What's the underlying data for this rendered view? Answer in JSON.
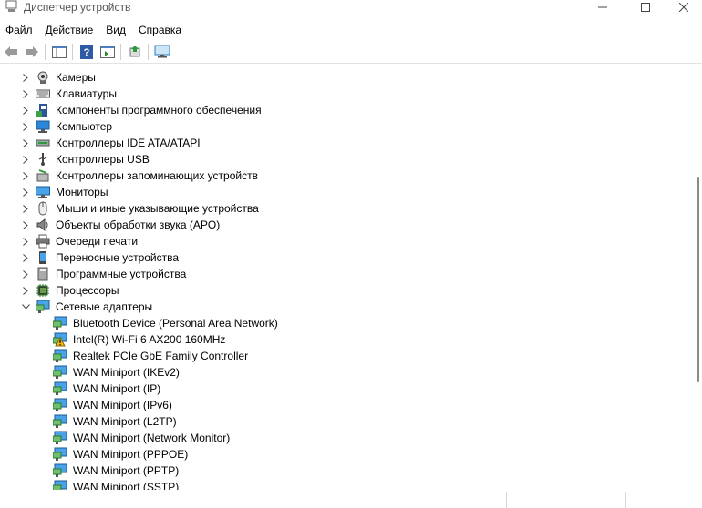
{
  "window": {
    "title": "Диспетчер устройств"
  },
  "menu": [
    "Файл",
    "Действие",
    "Вид",
    "Справка"
  ],
  "toolbar": [
    {
      "name": "back-button",
      "icon": "arrow-left-icon"
    },
    {
      "name": "forward-button",
      "icon": "arrow-right-icon"
    },
    {
      "name": "show-hide-tree-button",
      "icon": "tree-panel-icon"
    },
    {
      "name": "help-button",
      "icon": "help-icon"
    },
    {
      "name": "properties-panel-button",
      "icon": "properties-icon"
    },
    {
      "name": "update-driver-button",
      "icon": "update-driver-icon"
    },
    {
      "name": "scan-hardware-button",
      "icon": "monitor-scan-icon"
    }
  ],
  "tree": {
    "categories": [
      {
        "label": "Камеры",
        "icon": "camera-icon",
        "expanded": false
      },
      {
        "label": "Клавиатуры",
        "icon": "keyboard-icon",
        "expanded": false
      },
      {
        "label": "Компоненты программного обеспечения",
        "icon": "software-component-icon",
        "expanded": false
      },
      {
        "label": "Компьютер",
        "icon": "computer-icon",
        "expanded": false
      },
      {
        "label": "Контроллеры IDE ATA/ATAPI",
        "icon": "ide-controller-icon",
        "expanded": false
      },
      {
        "label": "Контроллеры USB",
        "icon": "usb-icon",
        "expanded": false
      },
      {
        "label": "Контроллеры запоминающих устройств",
        "icon": "storage-controller-icon",
        "expanded": false
      },
      {
        "label": "Мониторы",
        "icon": "monitor-icon",
        "expanded": false
      },
      {
        "label": "Мыши и иные указывающие устройства",
        "icon": "mouse-icon",
        "expanded": false
      },
      {
        "label": "Объекты обработки звука (APO)",
        "icon": "speaker-icon",
        "expanded": false
      },
      {
        "label": "Очереди печати",
        "icon": "printer-icon",
        "expanded": false
      },
      {
        "label": "Переносные устройства",
        "icon": "portable-device-icon",
        "expanded": false
      },
      {
        "label": "Программные устройства",
        "icon": "software-device-icon",
        "expanded": false
      },
      {
        "label": "Процессоры",
        "icon": "processor-icon",
        "expanded": false
      },
      {
        "label": "Сетевые адаптеры",
        "icon": "network-adapter-icon",
        "expanded": true,
        "children": [
          {
            "label": "Bluetooth Device (Personal Area Network)",
            "warning": false
          },
          {
            "label": "Intel(R) Wi-Fi 6 AX200 160MHz",
            "warning": true
          },
          {
            "label": "Realtek PCIe GbE Family Controller",
            "warning": false
          },
          {
            "label": "WAN Miniport (IKEv2)",
            "warning": false
          },
          {
            "label": "WAN Miniport (IP)",
            "warning": false
          },
          {
            "label": "WAN Miniport (IPv6)",
            "warning": false
          },
          {
            "label": "WAN Miniport (L2TP)",
            "warning": false
          },
          {
            "label": "WAN Miniport (Network Monitor)",
            "warning": false
          },
          {
            "label": "WAN Miniport (PPPOE)",
            "warning": false
          },
          {
            "label": "WAN Miniport (PPTP)",
            "warning": false
          },
          {
            "label": "WAN Miniport (SSTP)",
            "warning": false
          }
        ]
      }
    ]
  },
  "colors": {
    "accent": "#0b78d4",
    "warning": "#f2b90a"
  }
}
